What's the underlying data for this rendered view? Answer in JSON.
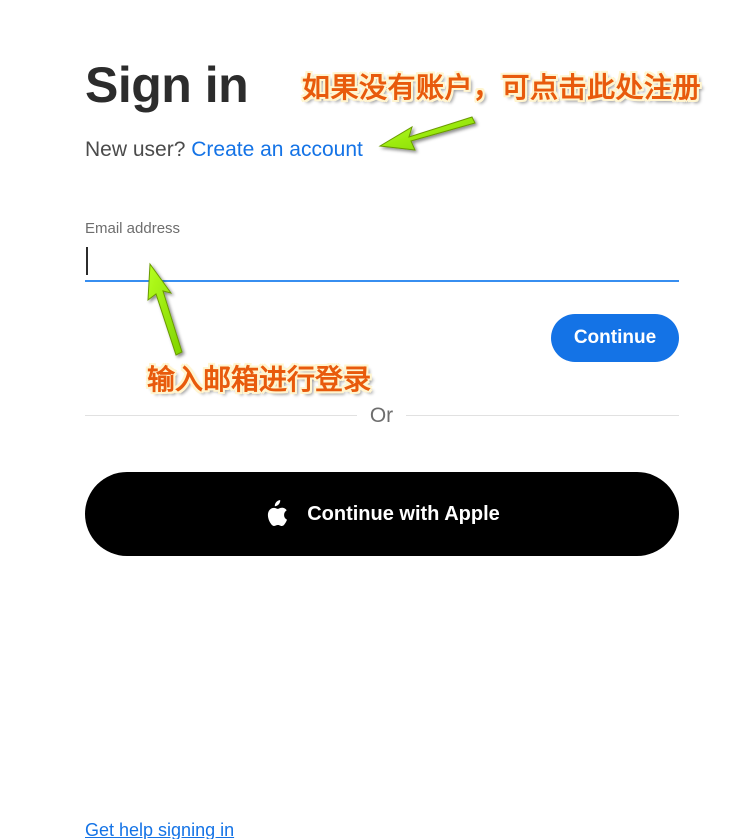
{
  "header": {
    "title": "Sign in",
    "new_user_prefix": "New user?",
    "create_account_link": "Create an account"
  },
  "form": {
    "email_label": "Email address",
    "email_value": "",
    "continue_label": "Continue"
  },
  "divider": {
    "or_label": "Or"
  },
  "social": {
    "apple_label": "Continue with Apple",
    "apple_icon": "apple-logo-icon"
  },
  "footer": {
    "help_link": "Get help signing in"
  },
  "annotations": {
    "create_account_note": "如果没有账户，可点击此处注册",
    "email_note": "输入邮箱进行登录",
    "note_color": "#e85a0c",
    "arrow_color": "#8fe000"
  },
  "colors": {
    "accent": "#1473e6",
    "input_underline": "#378ef0",
    "apple_button_bg": "#000000"
  }
}
